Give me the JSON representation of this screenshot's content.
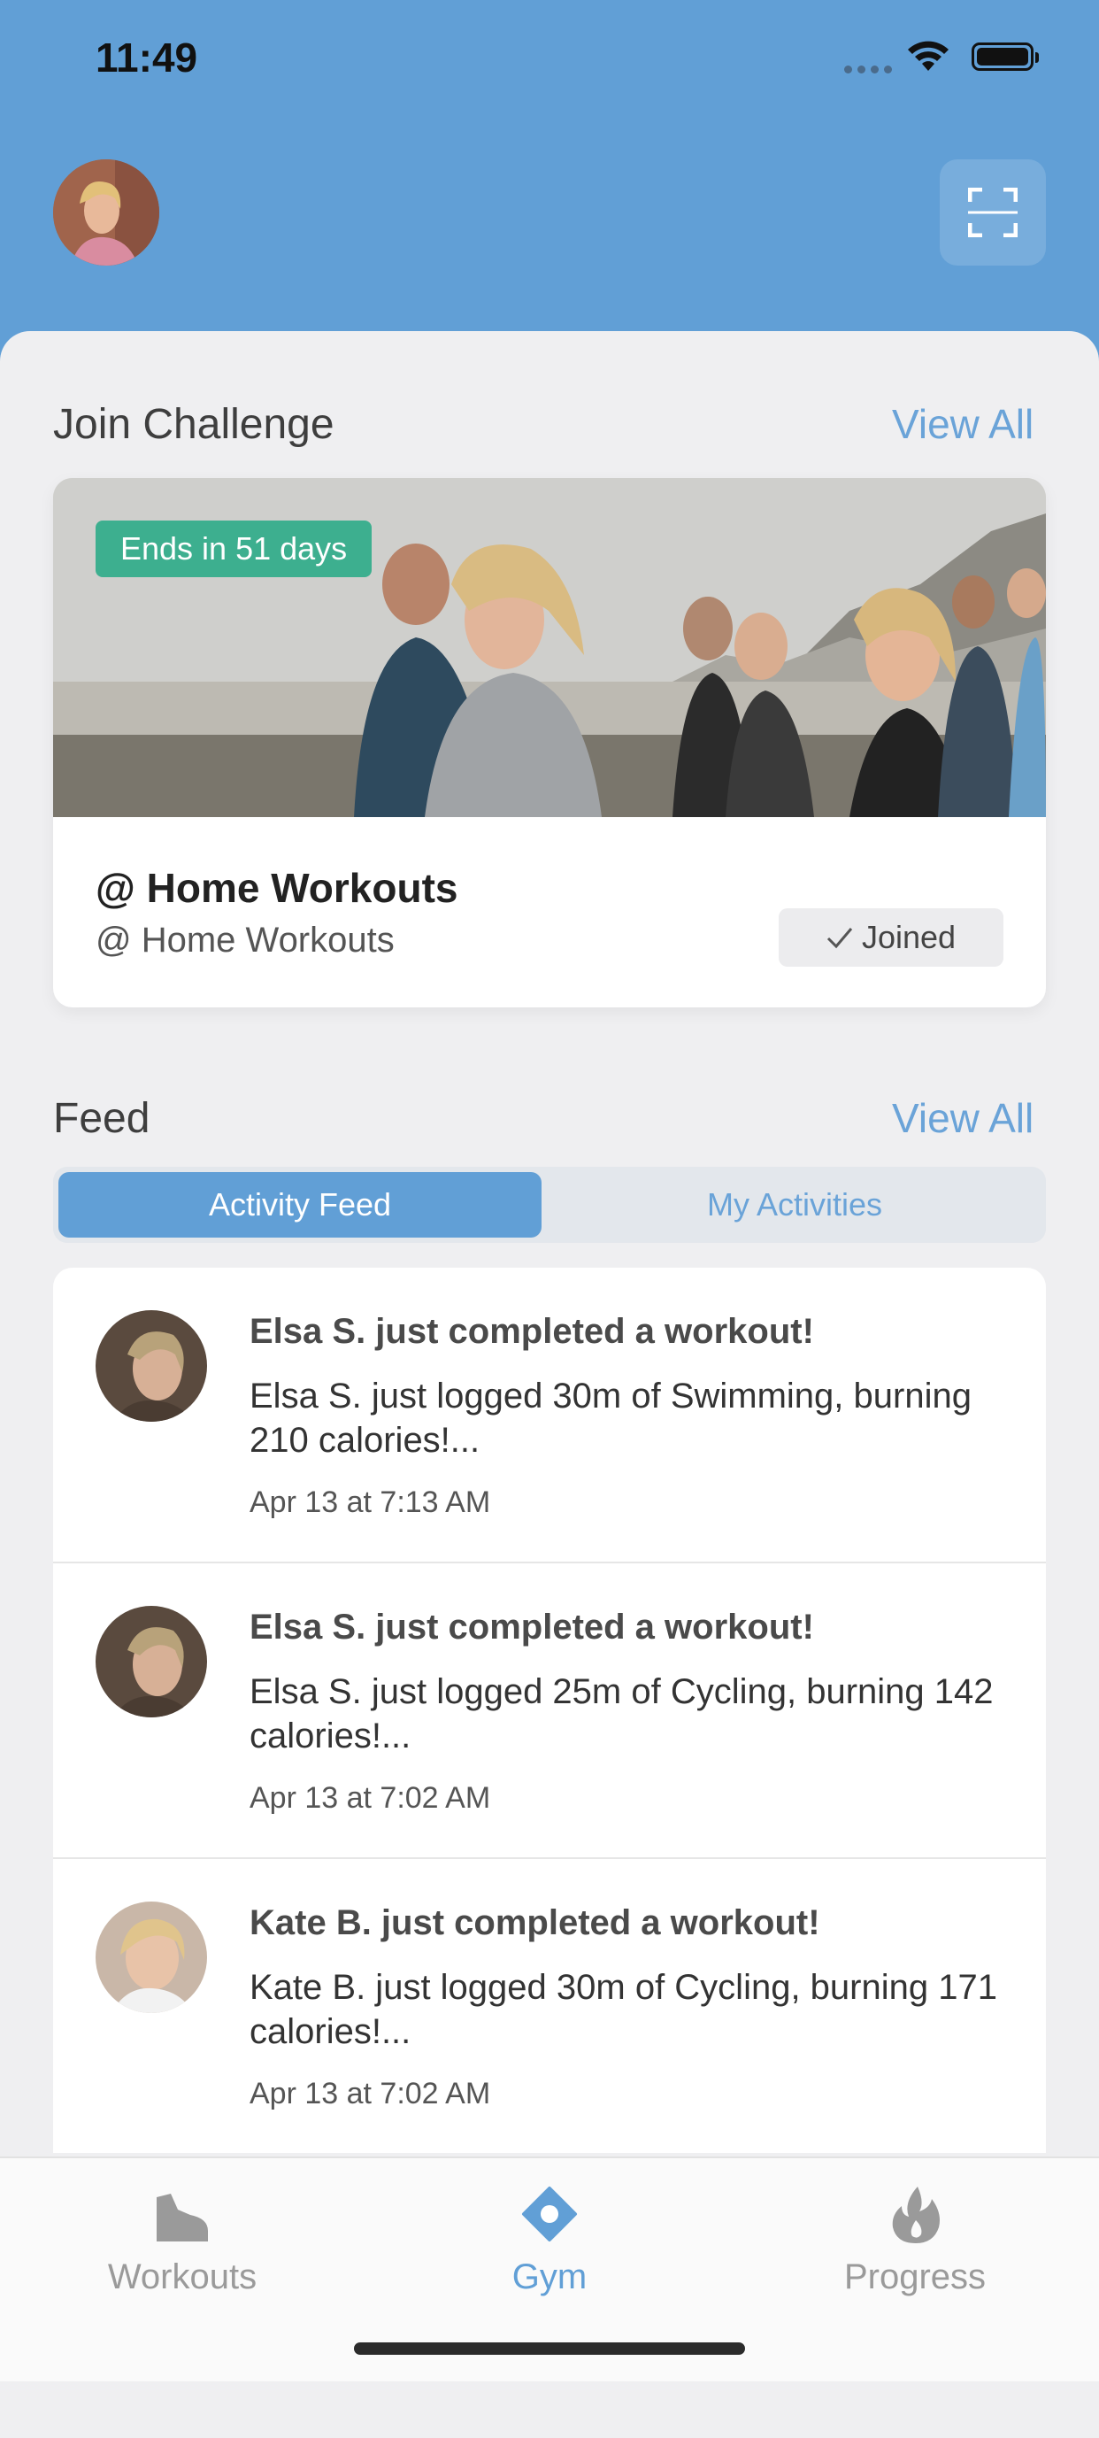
{
  "status_bar": {
    "time": "11:49"
  },
  "challenge_section": {
    "title": "Join Challenge",
    "view_all": "View All",
    "card": {
      "badge": "Ends in 51 days",
      "title": "@ Home Workouts",
      "subtitle": "@ Home Workouts",
      "joined_label": "Joined"
    }
  },
  "feed_section": {
    "title": "Feed",
    "view_all": "View All",
    "tabs": [
      {
        "label": "Activity Feed",
        "active": true
      },
      {
        "label": "My Activities",
        "active": false
      }
    ],
    "items": [
      {
        "title": "Elsa S. just completed a workout!",
        "body": "Elsa S. just logged 30m of Swimming, burning 210 calories!...",
        "time": "Apr 13 at 7:13 AM"
      },
      {
        "title": "Elsa S. just completed a workout!",
        "body": "Elsa S. just logged 25m of Cycling, burning 142 calories!...",
        "time": "Apr 13 at 7:02 AM"
      },
      {
        "title": "Kate B. just completed a workout!",
        "body": "Kate B. just logged 30m of Cycling, burning 171 calories!...",
        "time": "Apr 13 at 7:02 AM"
      }
    ]
  },
  "tab_bar": {
    "items": [
      {
        "label": "Workouts",
        "icon": "shoe-icon",
        "active": false
      },
      {
        "label": "Gym",
        "icon": "location-diamond-icon",
        "active": true
      },
      {
        "label": "Progress",
        "icon": "flame-icon",
        "active": false
      }
    ]
  },
  "colors": {
    "header": "#619fd6",
    "accent": "#6aa3d8",
    "badge": "#3daf8f",
    "tab_inactive": "#9a9a9a"
  }
}
